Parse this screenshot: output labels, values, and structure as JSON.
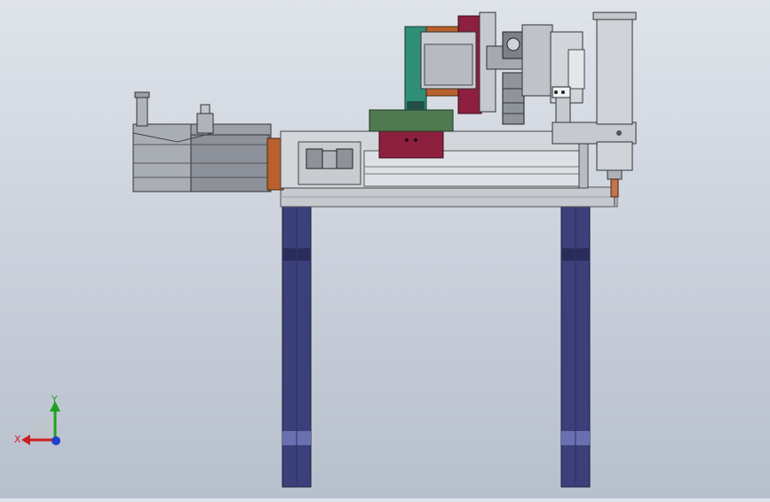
{
  "viewport": {
    "background_top": "#dfe3ea",
    "background_bottom": "#b7bfcc"
  },
  "triad": {
    "x_label": "X",
    "y_label": "Y",
    "x_color": "#cc1f1f",
    "y_color": "#1fa11f",
    "z_color": "#1f3fcc"
  },
  "model": {
    "description_icon": "cad-assembly-side-view",
    "leg_color": "#3b3f7a",
    "frame_color": "#c6c9cf",
    "accent_green": "#2f8f78",
    "accent_orange": "#b8612d",
    "accent_crimson": "#8d1f3f",
    "accent_olive": "#4f7a4f"
  }
}
